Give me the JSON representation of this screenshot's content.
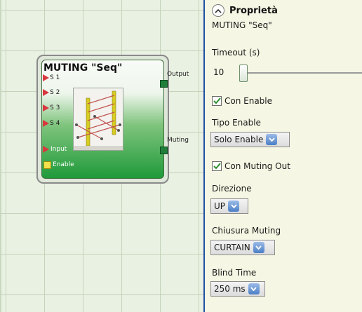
{
  "block": {
    "title": "MUTING \"Seq\"",
    "inputs": [
      "S 1",
      "S 2",
      "S 3",
      "S 4",
      "Input"
    ],
    "enable_label": "Enable",
    "outputs": [
      "Output",
      "Muting"
    ]
  },
  "panel": {
    "title": "Proprietà",
    "subtitle": "MUTING \"Seq\"",
    "timeout": {
      "label": "Timeout (s)",
      "value": "10"
    },
    "con_enable": {
      "label": "Con Enable",
      "checked": true
    },
    "tipo_enable": {
      "label": "Tipo Enable",
      "value": "Solo Enable"
    },
    "con_muting_out": {
      "label": "Con Muting Out",
      "checked": true
    },
    "direzione": {
      "label": "Direzione",
      "value": "UP"
    },
    "chiusura_muting": {
      "label": "Chiusura Muting",
      "value": "CURTAIN"
    },
    "blind_time": {
      "label": "Blind Time",
      "value": "250 ms"
    }
  },
  "icons": {
    "collapse": "chevron-up-icon",
    "checkbox": "checkmark-icon",
    "dropdown": "chevron-down-icon",
    "input_pin": "red-triangle-pin-icon",
    "output_pin": "green-square-pin-icon",
    "enable_pin": "yellow-square-pin-icon"
  },
  "colors": {
    "canvas_bg": "#e9f1e2",
    "grid_line": "#c5d3bb",
    "panel_bg": "#f6f6e4",
    "divider": "#1f4fa0",
    "block_green": "#1f9a3a",
    "input_pin": "#d9383e",
    "output_pin": "#1f7f3a",
    "enable_pin": "#f4e14b",
    "checkbox_mark": "#2f8f2f",
    "dropdown_button": "#4c7fc6"
  }
}
